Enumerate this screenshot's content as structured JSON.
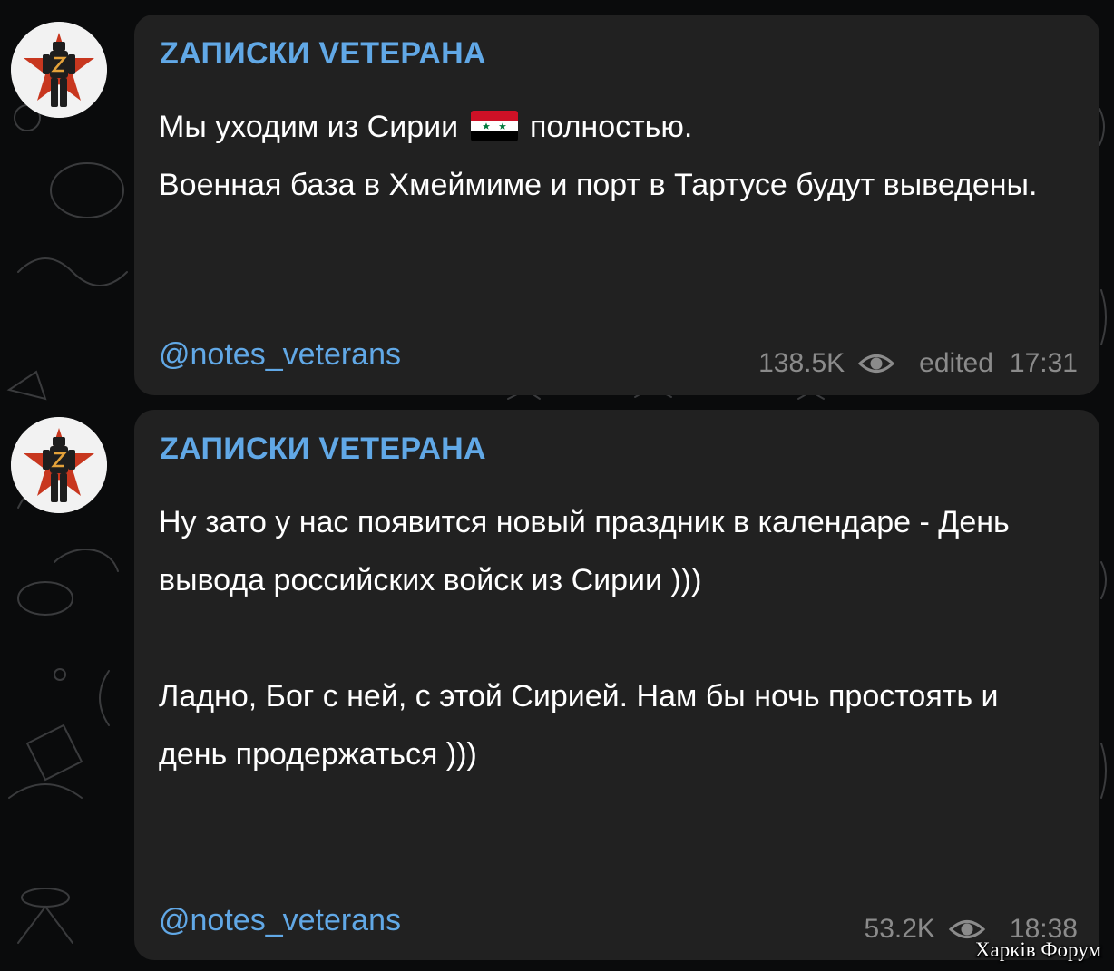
{
  "messages": [
    {
      "channel_name": "ZАПИСКИ VЕTЕРАНА",
      "text_before_flag": "Мы уходим из Сирии",
      "flag_icon": "syria-flag-icon",
      "text_after_flag": " полностью.",
      "text_rest": "Военная база в Хмеймиме и порт в Тартусе будут выведены.",
      "channel_link": "@notes_veterans",
      "views": "138.5K",
      "edited": "edited",
      "time": "17:31"
    },
    {
      "channel_name": "ZАПИСКИ VЕTЕРАНА",
      "paragraph_1": "Ну зато у нас появится новый праздник в календаре - День вывода российских войск из Сирии )))",
      "paragraph_2": "Ладно, Бог с ней, с этой Сирией. Нам бы ночь простоять и день продержаться )))",
      "channel_link": "@notes_veterans",
      "views": "53.2K",
      "time": "18:38"
    }
  ],
  "watermark": "Харків Форум",
  "colors": {
    "background": "#0a0b0c",
    "bubble": "#212121",
    "accent": "#61a8e6",
    "text": "#ffffff",
    "meta": "#8b8b8b"
  }
}
